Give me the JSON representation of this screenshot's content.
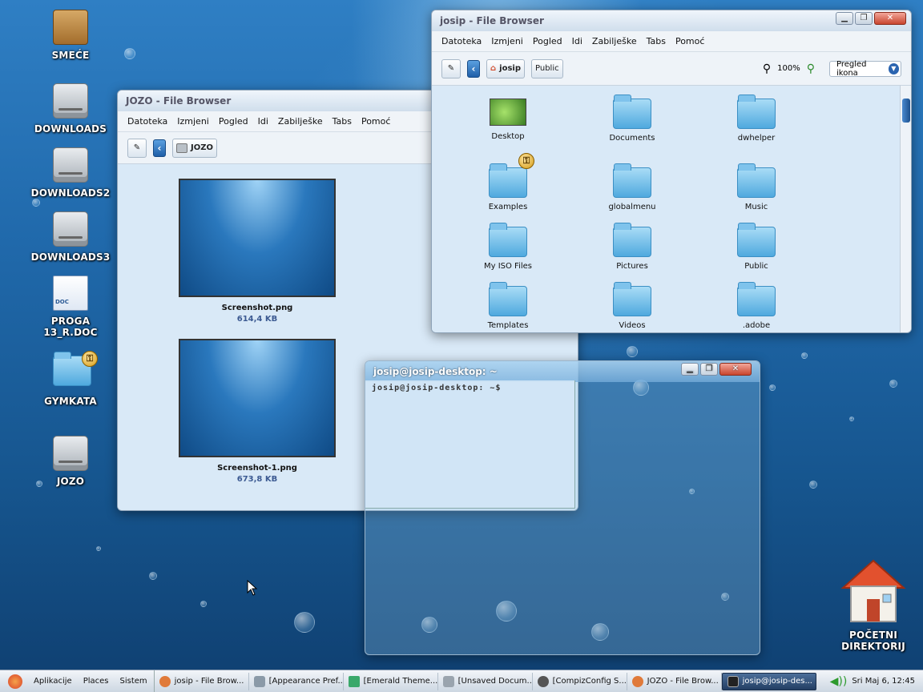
{
  "desktop": {
    "icons": [
      {
        "label": "SMEĆE"
      },
      {
        "label": "DOWNLOADS"
      },
      {
        "label": "DOWNLOADS2"
      },
      {
        "label": "DOWNLOADS3"
      },
      {
        "label": "PROGA 13_R.DOC"
      },
      {
        "label": "GYMKATA"
      },
      {
        "label": "JOZO"
      },
      {
        "label": "POČETNI DIREKTORIJ"
      }
    ],
    "doc_badge": "DOC"
  },
  "menu": [
    "Datoteka",
    "Izmjeni",
    "Pogled",
    "Idi",
    "Zabilješke",
    "Tabs",
    "Pomoć"
  ],
  "win_jozo": {
    "title": "JOZO - File Browser",
    "location": "JOZO",
    "files": [
      {
        "name": "Screenshot.png",
        "size": "614,4 KB"
      },
      {
        "name": "Screenshot-1.png",
        "size": "673,8 KB"
      }
    ]
  },
  "win_josip": {
    "title": "josip - File Browser",
    "path": [
      "josip",
      "Public"
    ],
    "zoom": "100%",
    "view_mode": "Pregled ikona",
    "items": [
      "Desktop",
      "Documents",
      "dwhelper",
      "Examples",
      "globalmenu",
      "Music",
      "My ISO Files",
      "Pictures",
      "Public",
      "Templates",
      "Videos",
      ".adobe"
    ]
  },
  "terminal": {
    "title": "josip@josip-desktop: ~",
    "prompt": "josip@josip-desktop: ~$"
  },
  "taskbar": {
    "menus": [
      "Aplikacije",
      "Places",
      "Sistem"
    ],
    "tasks": [
      "josip - File Brow...",
      "[Appearance Pref...",
      "[Emerald Theme...",
      "[Unsaved Docum...",
      "[CompizConfig S...",
      "JOZO - File Brow...",
      "josip@josip-des..."
    ],
    "clock": "Sri Maj  6, 12:45"
  }
}
